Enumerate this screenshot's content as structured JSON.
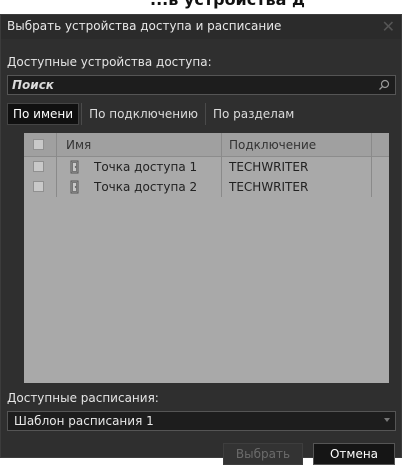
{
  "background_peek_text": "...ь устройства д",
  "dialog": {
    "title": "Выбрать устройства доступа и расписание",
    "close_glyph": "✕"
  },
  "devices": {
    "label": "Доступные устройства доступа:",
    "search_placeholder": "Поиск",
    "tabs": [
      "По имени",
      "По подключению",
      "По разделам"
    ],
    "active_tab": "По имени",
    "columns": {
      "name": "Имя",
      "connection": "Подключение"
    },
    "rows": [
      {
        "name": "Точка доступа 1",
        "connection": "TECHWRITER",
        "checked": false,
        "icon": "door-icon"
      },
      {
        "name": "Точка доступа 2",
        "connection": "TECHWRITER",
        "checked": false,
        "icon": "door-icon"
      }
    ]
  },
  "schedules": {
    "label": "Доступные расписания:",
    "selected": "Шаблон расписания 1"
  },
  "buttons": {
    "select": "Выбрать",
    "cancel": "Отмена"
  },
  "colors": {
    "dialog_bg": "#2f2f2f",
    "table_bg": "#a9a9a9",
    "active_tab_bg": "#101010"
  }
}
